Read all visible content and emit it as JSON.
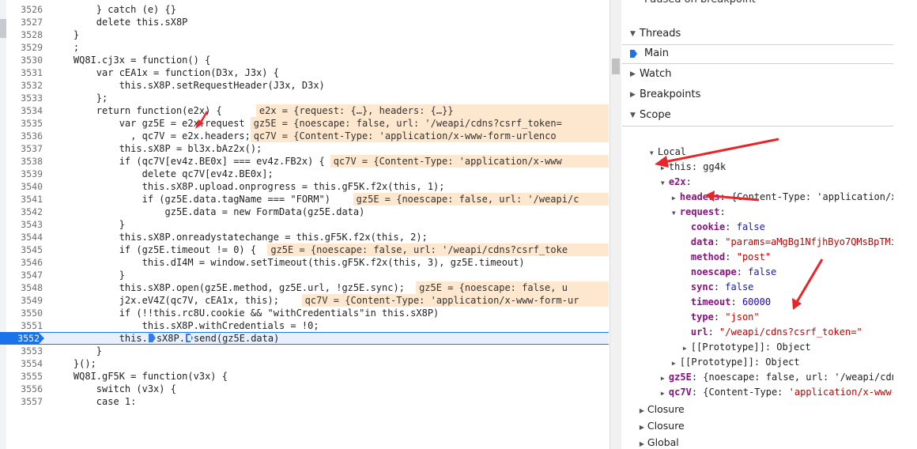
{
  "editor": {
    "lines": [
      {
        "n": "3526",
        "code": "        } catch (e) {}"
      },
      {
        "n": "3527",
        "code": "        delete this.sX8P"
      },
      {
        "n": "3528",
        "code": "    }"
      },
      {
        "n": "3529",
        "code": "    ;"
      },
      {
        "n": "3530",
        "code": "    WQ8I.cj3x = function() {"
      },
      {
        "n": "3531",
        "code": "        var cEA1x = function(D3x, J3x) {"
      },
      {
        "n": "3532",
        "code": "            this.sX8P.setRequestHeader(J3x, D3x)"
      },
      {
        "n": "3533",
        "code": "        };"
      },
      {
        "n": "3534",
        "code": "        return function(e2x) {"
      },
      {
        "n": "3535",
        "code": "            var gz5E = e2x.request"
      },
      {
        "n": "3536",
        "code": "              , qc7V = e2x.headers;"
      },
      {
        "n": "3537",
        "code": "            this.sX8P = bl3x.bAz2x();"
      },
      {
        "n": "3538",
        "code": "            if (qc7V[ev4z.BE0x] === ev4z.FB2x) {"
      },
      {
        "n": "3539",
        "code": "                delete qc7V[ev4z.BE0x];"
      },
      {
        "n": "3540",
        "code": "                this.sX8P.upload.onprogress = this.gF5K.f2x(this, 1);"
      },
      {
        "n": "3541",
        "code": "                if (gz5E.data.tagName === \"FORM\")"
      },
      {
        "n": "3542",
        "code": "                    gz5E.data = new FormData(gz5E.data)"
      },
      {
        "n": "3543",
        "code": "            }"
      },
      {
        "n": "3544",
        "code": "            this.sX8P.onreadystatechange = this.gF5K.f2x(this, 2);"
      },
      {
        "n": "3545",
        "code": "            if (gz5E.timeout != 0) {"
      },
      {
        "n": "3546",
        "code": "                this.dI4M = window.setTimeout(this.gF5K.f2x(this, 3), gz5E.timeout)"
      },
      {
        "n": "3547",
        "code": "            }"
      },
      {
        "n": "3548",
        "code": "            this.sX8P.open(gz5E.method, gz5E.url, !gz5E.sync);"
      },
      {
        "n": "3549",
        "code": "            j2x.eV4Z(qc7V, cEA1x, this);"
      },
      {
        "n": "3550",
        "code": "            if (!!this.rc8U.cookie && \"withCredentials\"in this.sX8P)"
      },
      {
        "n": "3551",
        "code": "                this.sX8P.withCredentials = !0;"
      },
      {
        "n": "3552",
        "code": ""
      },
      {
        "n": "3553",
        "code": "        }"
      },
      {
        "n": "3554",
        "code": "    }();"
      },
      {
        "n": "3555",
        "code": "    WQ8I.gF5K = function(v3x) {"
      },
      {
        "n": "3556",
        "code": "        switch (v3x) {"
      },
      {
        "n": "3557",
        "code": "        case 1:"
      }
    ],
    "current_line": {
      "prefix": "            this.",
      "mid": "sX8P.",
      "suffix": "send(gz5E.data)"
    },
    "hints": [
      {
        "line": 8,
        "col": 36,
        "text": "e2x = {request: {…}, headers: {…}}"
      },
      {
        "line": 9,
        "col": 35,
        "text": "gz5E = {noescape: false, url: '/weapi/cdns?csrf_token="
      },
      {
        "line": 10,
        "col": 35,
        "text": "qc7V = {Content-Type: 'application/x-www-form-urlenco"
      },
      {
        "line": 12,
        "col": 49,
        "text": "qc7V = {Content-Type: 'application/x-www"
      },
      {
        "line": 15,
        "col": 53,
        "text": "gz5E = {noescape: false, url: '/weapi/c"
      },
      {
        "line": 19,
        "col": 38,
        "text": "gz5E = {noescape: false, url: '/weapi/cdns?csrf_toke"
      },
      {
        "line": 22,
        "col": 64,
        "text": "gz5E = {noescape: false, u"
      },
      {
        "line": 23,
        "col": 44,
        "text": "qc7V = {Content-Type: 'application/x-www-form-ur"
      }
    ]
  },
  "sidebar": {
    "paused_text": "Paused on breakpoint",
    "threads_label": "Threads",
    "main_thread": "Main",
    "watch_label": "Watch",
    "breakpoints_label": "Breakpoints",
    "scope_label": "Scope",
    "local_label": "Local",
    "this_key": "this",
    "this_val": "gg4k",
    "e2x_key": "e2x",
    "headers_key": "headers",
    "headers_val": "{Content-Type: 'application/x",
    "request_key": "request",
    "cookie_key": "cookie",
    "cookie_val": "false",
    "data_key": "data",
    "data_val": "\"params=aMgBg1NfjhByo7QMsBpTMi",
    "method_key": "method",
    "method_val": "\"post\"",
    "noescape_key": "noescape",
    "noescape_val": "false",
    "sync_key": "sync",
    "sync_val": "false",
    "timeout_key": "timeout",
    "timeout_val": "60000",
    "type_key": "type",
    "type_val": "\"json\"",
    "url_key": "url",
    "url_val": "\"/weapi/cdns?csrf_token=\"",
    "proto_key": "[[Prototype]]",
    "proto_val": "Object",
    "gz5e_key": "gz5E",
    "gz5e_val": "{noescape: false, url: '/weapi/cdn",
    "qc7v_key": "qc7V",
    "qc7v_prefix": "{Content-Type: ",
    "qc7v_str": "'application/x-www-",
    "closure_label": "Closure",
    "global_label": "Global"
  }
}
